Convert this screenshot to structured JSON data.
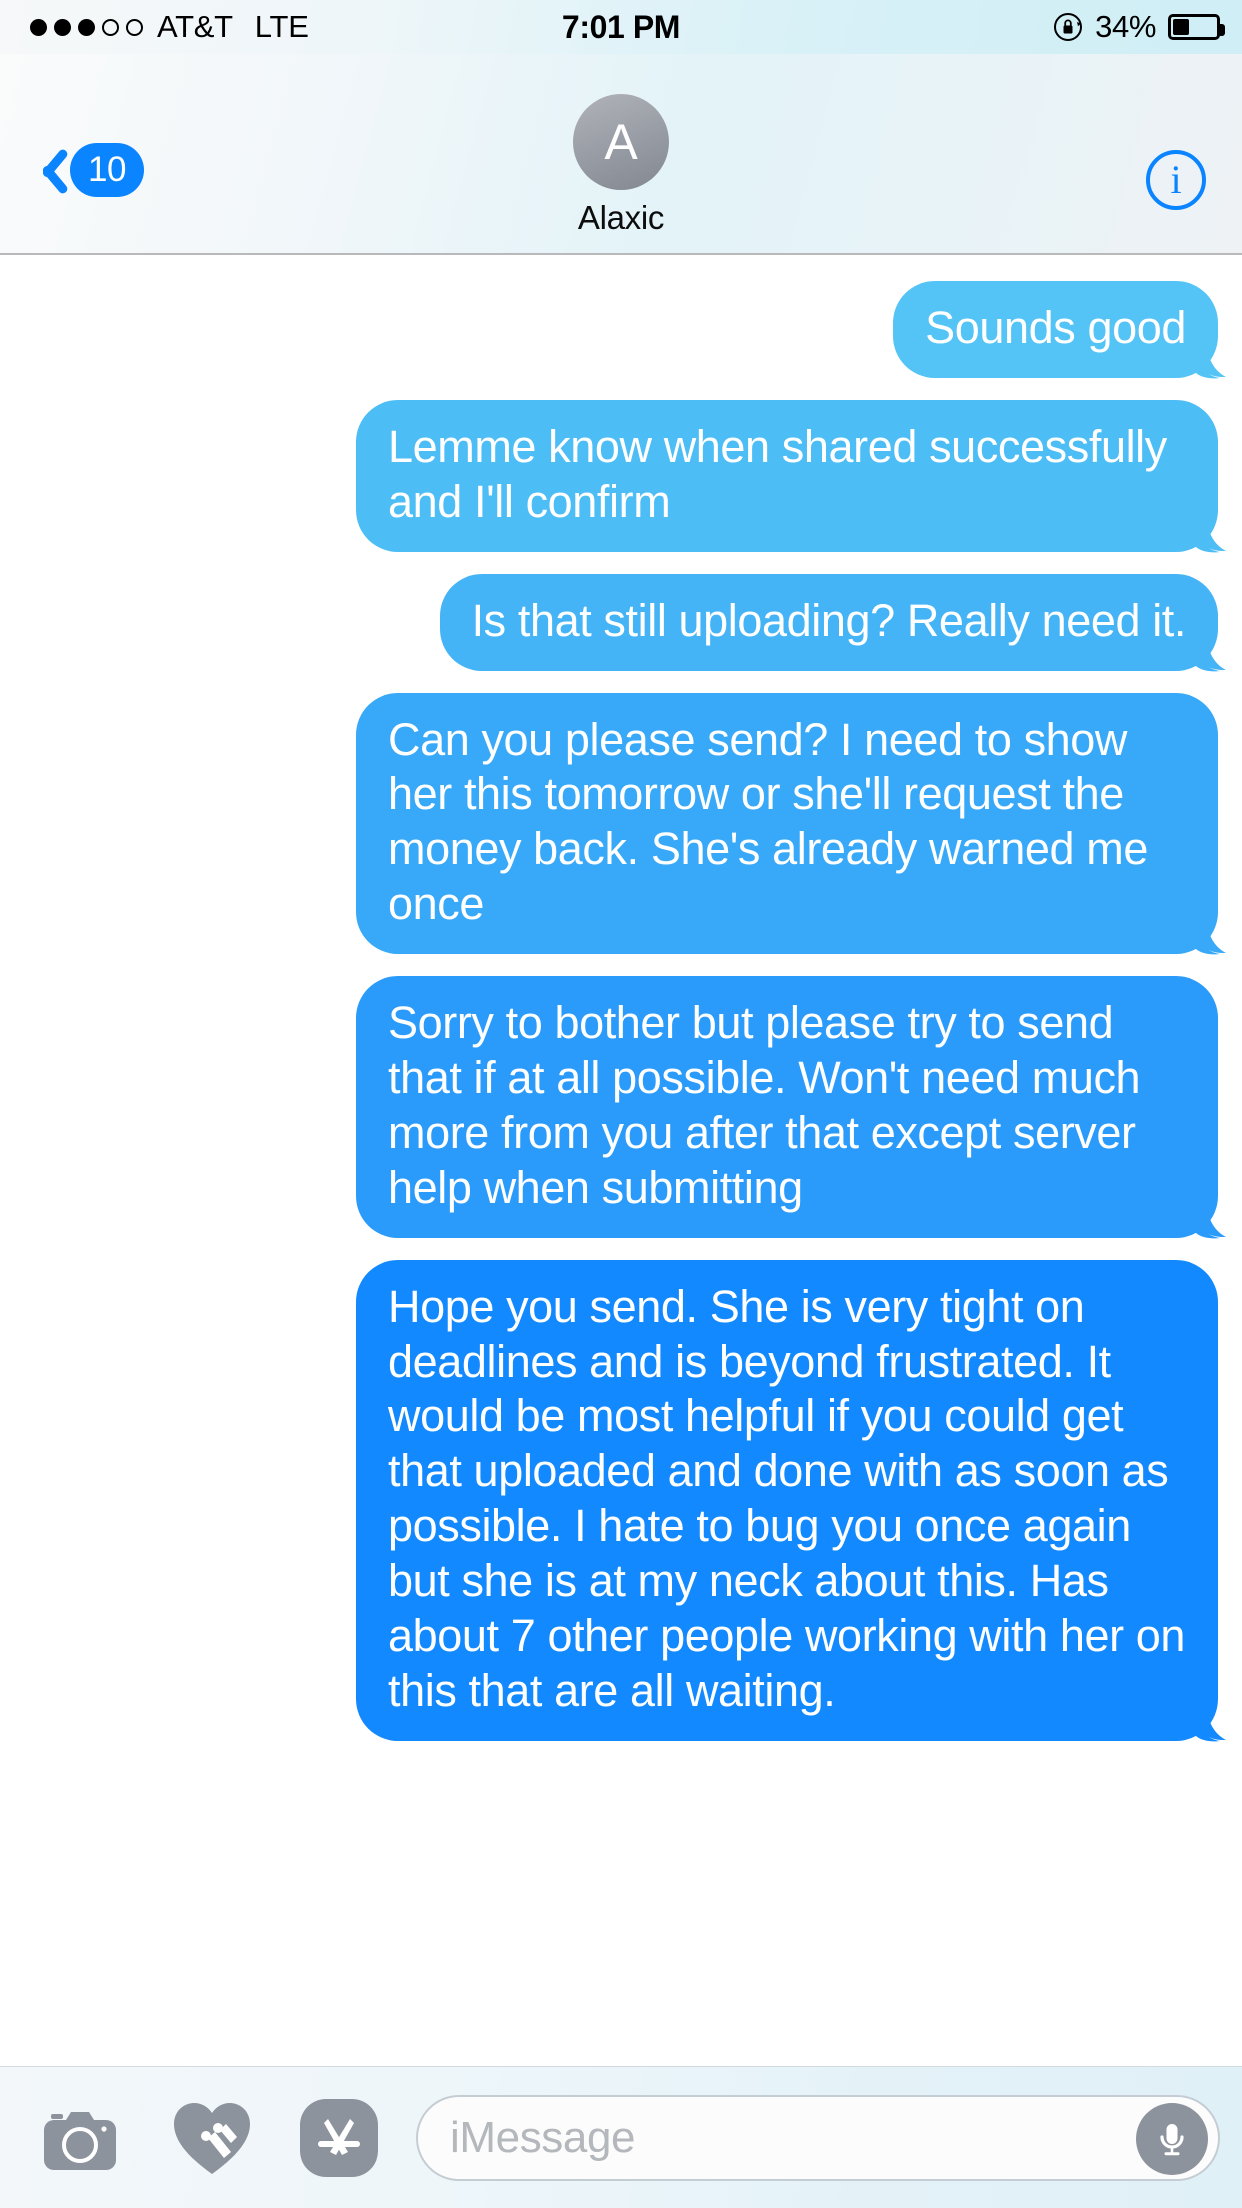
{
  "status_bar": {
    "signal_dots_filled": 3,
    "signal_dots_total": 5,
    "carrier": "AT&T",
    "network": "LTE",
    "time": "7:01 PM",
    "rotation_lock_icon": "rotation-lock-icon",
    "battery_percent": "34%",
    "battery_level": 34
  },
  "nav_bar": {
    "back_icon": "chevron-left-icon",
    "unread_badge": "10",
    "avatar_initial": "A",
    "contact_name": "Alaxic",
    "info_icon": "i",
    "accent_color": "#0a84ff"
  },
  "thread": {
    "messages": [
      {
        "text": "Sounds good",
        "sender": "me",
        "color": "#54c3f5"
      },
      {
        "text": "Lemme know when shared successfully and I'll confirm",
        "sender": "me",
        "color": "#4dbdf5"
      },
      {
        "text": "Is that still uploading? Really need it.",
        "sender": "me",
        "color": "#45b4f6"
      },
      {
        "text": "Can you please send? I need to show her this tomorrow or she'll request the money back. She's already warned me once",
        "sender": "me",
        "color": "#38a8f8"
      },
      {
        "text": "Sorry to bother but please try to send that if at all possible. Won't need much more from you after that except server help when submitting",
        "sender": "me",
        "color": "#2b9bfb"
      },
      {
        "text": "Hope you send. She is very tight on deadlines and is beyond frustrated. It would be most helpful if you could get that uploaded and done with as soon as possible. I hate to bug you once again but she is at my neck about this. Has about 7 other people working with her on this that are all waiting.",
        "sender": "me",
        "color": "#1289fe"
      }
    ]
  },
  "toolbar": {
    "camera_icon": "camera-icon",
    "digital_touch_icon": "digital-touch-heart-icon",
    "app_store_icon": "app-store-icon",
    "input_placeholder": "iMessage",
    "input_value": "",
    "mic_icon": "microphone-icon"
  }
}
